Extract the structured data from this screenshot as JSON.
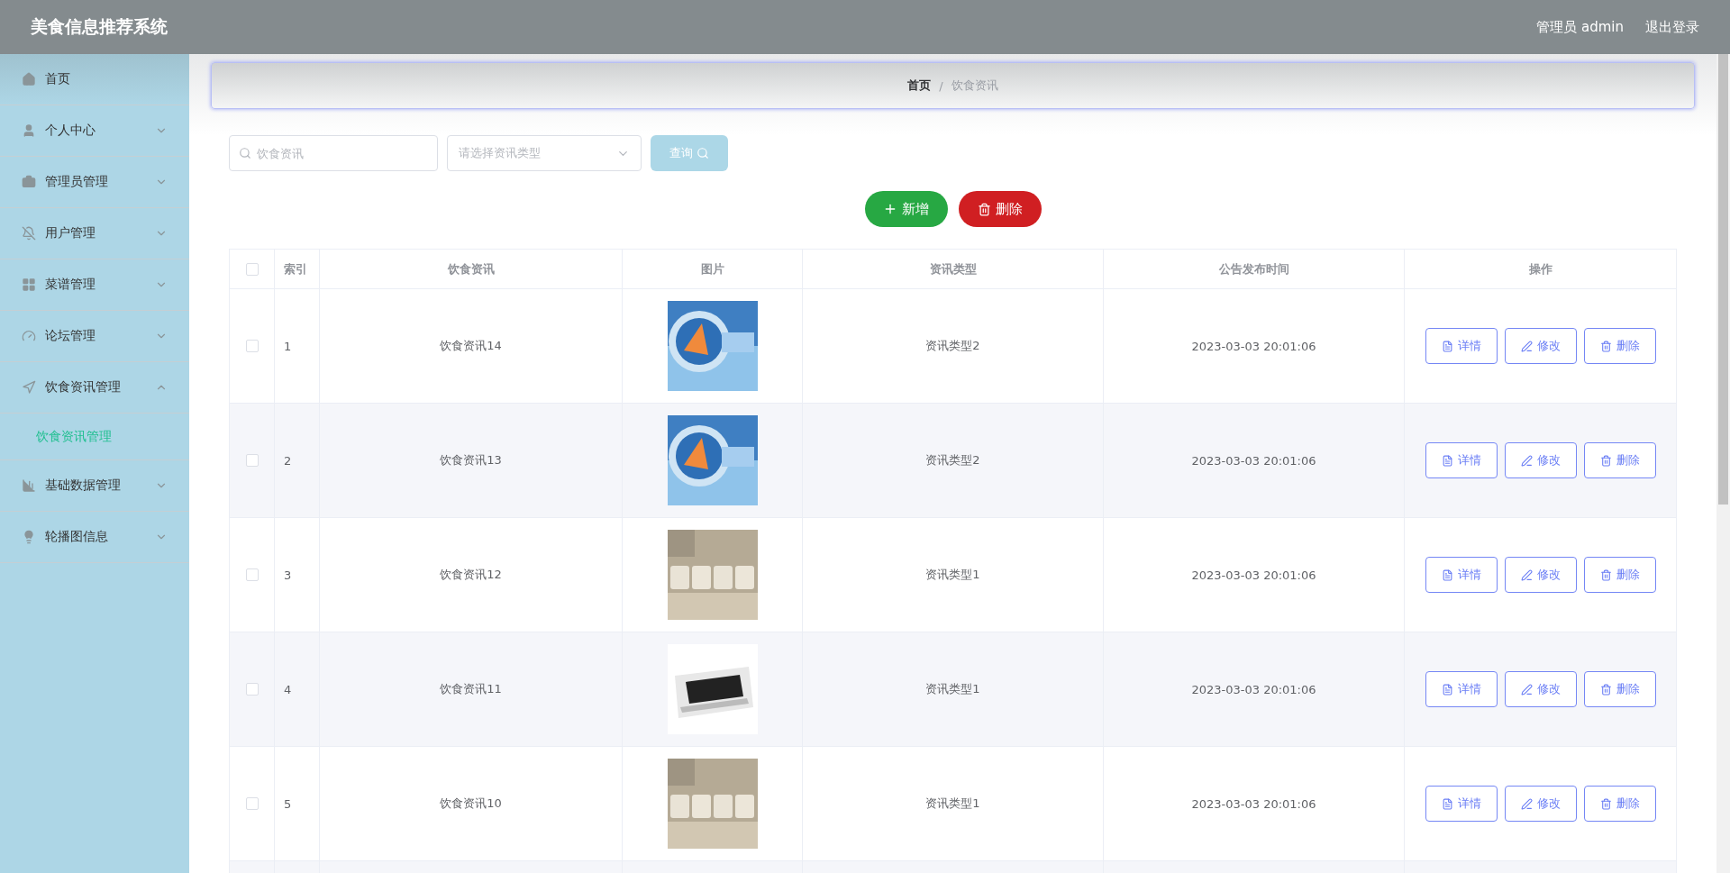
{
  "header": {
    "title": "美食信息推荐系统",
    "user": "管理员 admin",
    "logout": "退出登录"
  },
  "sidebar": {
    "items": [
      {
        "label": "首页",
        "kind": "link"
      },
      {
        "label": "个人中心",
        "kind": "menu",
        "expanded": false
      },
      {
        "label": "管理员管理",
        "kind": "menu",
        "expanded": false
      },
      {
        "label": "用户管理",
        "kind": "menu",
        "expanded": false
      },
      {
        "label": "菜谱管理",
        "kind": "menu",
        "expanded": false
      },
      {
        "label": "论坛管理",
        "kind": "menu",
        "expanded": false
      },
      {
        "label": "饮食资讯管理",
        "kind": "menu",
        "expanded": true,
        "children": [
          {
            "label": "饮食资讯管理",
            "selected": true
          }
        ]
      },
      {
        "label": "基础数据管理",
        "kind": "menu",
        "expanded": false
      },
      {
        "label": "轮播图信息",
        "kind": "menu",
        "expanded": false
      }
    ]
  },
  "breadcrumb": [
    "首页",
    "/",
    "饮食资讯"
  ],
  "search": {
    "placeholder": "饮食资讯",
    "select_placeholder": "请选择资讯类型",
    "query_button": "查询"
  },
  "actions": {
    "add": "新增",
    "delete": "删除"
  },
  "table": {
    "select_all_checked": false,
    "columns": [
      "索引",
      "饮食资讯",
      "图片",
      "资讯类型",
      "公告发布时间",
      "操作"
    ],
    "rows": [
      {
        "index": "1",
        "title": "饮食资讯14",
        "type": "资讯类型2",
        "time": "2023-03-03 20:01:06",
        "checked": false,
        "buttons": [
          "详情",
          "修改",
          "删除"
        ]
      },
      {
        "index": "2",
        "title": "饮食资讯13",
        "type": "资讯类型2",
        "time": "2023-03-03 20:01:06",
        "checked": false,
        "buttons": [
          "详情",
          "修改",
          "删除"
        ]
      },
      {
        "index": "3",
        "title": "饮食资讯12",
        "type": "资讯类型1",
        "time": "2023-03-03 20:01:06",
        "checked": false,
        "buttons": [
          "详情",
          "修改",
          "删除"
        ]
      },
      {
        "index": "4",
        "title": "饮食资讯11",
        "type": "资讯类型1",
        "time": "2023-03-03 20:01:06",
        "checked": false,
        "buttons": [
          "详情",
          "修改",
          "删除"
        ]
      },
      {
        "index": "5",
        "title": "饮食资讯10",
        "type": "资讯类型1",
        "time": "2023-03-03 20:01:06",
        "checked": false,
        "buttons": [
          "详情",
          "修改",
          "删除"
        ]
      }
    ]
  }
}
